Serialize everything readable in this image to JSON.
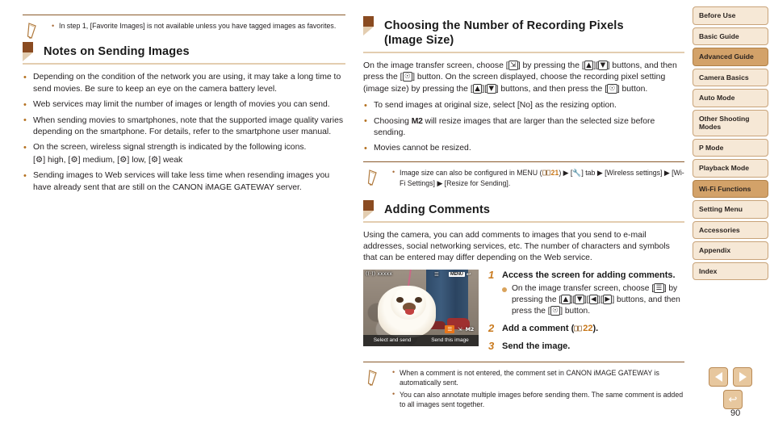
{
  "colors": {
    "heading_tag": "#8a4b21",
    "heading_rule": "#e3cdb0",
    "note_rule": "#8a5a2b",
    "bullet": "#b4701f",
    "step_number": "#c97a1e",
    "page_ref": "#c8781b",
    "nav_default_bg": "#f6e8d6",
    "nav_active_bg": "#d3a269",
    "nav_border": "#c8a379",
    "button_bg": "#e7c79e",
    "camera_highlight": "#e8751a"
  },
  "left_column": {
    "top_note": {
      "icon": "pencil-icon",
      "items": [
        "In step 1, [Favorite Images] is not available unless you have tagged images as favorites."
      ]
    },
    "heading": "Notes on Sending Images",
    "bullets": [
      "Depending on the condition of the network you are using, it may take a long time to send movies. Be sure to keep an eye on the camera battery level.",
      "Web services may limit the number of images or length of movies you can send.",
      "When sending movies to smartphones, note that the supported image quality varies depending on the smartphone. For details, refer to the smartphone user manual.",
      "On the screen, wireless signal strength is indicated by the following icons.",
      "Sending images to Web services will take less time when resending images you have already sent that are still on the CANON iMAGE GATEWAY server."
    ],
    "signal_line": {
      "entries": [
        {
          "icon": "signal-high-icon",
          "label": "high"
        },
        {
          "icon": "signal-medium-icon",
          "label": "medium"
        },
        {
          "icon": "signal-low-icon",
          "label": "low"
        },
        {
          "icon": "signal-weak-icon",
          "label": "weak"
        }
      ]
    }
  },
  "middle_column": {
    "section1": {
      "heading_line1": "Choosing the Number of Recording Pixels",
      "heading_line2": "(Image Size)",
      "paragraph_parts": {
        "p1": "On the image transfer screen, choose ",
        "icon1": "resize-icon",
        "p2": " by pressing the ",
        "icon_up": "up-button-icon",
        "icon_down": "down-button-icon",
        "p3": " buttons, and then press the ",
        "icon_func": "func-set-icon",
        "p4": " button. On the screen displayed, choose the recording pixel setting (image size) by pressing the ",
        "p5": " buttons, and then press the ",
        "p6": " button."
      },
      "bullets": [
        {
          "parts": [
            "To send images at original size, select [No] as the resizing option."
          ]
        },
        {
          "parts": [
            "Choosing ",
            "M2",
            " will resize images that are larger than the selected size before sending."
          ]
        },
        {
          "parts": [
            "Movies cannot be resized."
          ]
        }
      ],
      "note": {
        "icon": "pencil-icon",
        "text_parts": {
          "a": "Image size can also be configured in MENU (",
          "page_ref": "21",
          "b": ") ▶ [",
          "tab_icon": "wrench-tab-icon",
          "c": "] tab ▶ [Wireless settings] ▶ [Wi-Fi Settings] ▶ [Resize for Sending]."
        }
      }
    },
    "section2": {
      "heading": "Adding Comments",
      "paragraph": "Using the camera, you can add comments to images that you send to e-mail addresses, social networking services, etc. The number of characters and symbols that can be entered may differ depending on the Web service.",
      "camera_screen": {
        "wifi_label": "((·)) xxxxx",
        "signal_icon": "signal-icon",
        "menu_key": "MENU",
        "return_icon": "return-icon",
        "selected_tool_icon": "comment-icon",
        "resize_icon": "resize-icon",
        "size_label": "M2",
        "left_hint": "Select and send",
        "right_hint": "Send this image"
      },
      "steps": [
        {
          "number": "1",
          "title": "Access the screen for adding comments.",
          "substep_parts": {
            "a": "On the image transfer screen, choose [",
            "icon": "comment-icon",
            "b": "] by pressing the [",
            "up": "up-button-icon",
            "down": "down-button-icon",
            "left": "left-button-icon",
            "right": "right-button-icon",
            "c": "] buttons, and then press the [",
            "func": "func-set-icon",
            "d": "] button."
          }
        },
        {
          "number": "2",
          "title_parts": {
            "a": "Add a comment (",
            "page_ref": "22",
            "b": ")."
          }
        },
        {
          "number": "3",
          "title": "Send the image."
        }
      ],
      "note": {
        "icon": "pencil-icon",
        "items": [
          "When a comment is not entered, the comment set in CANON iMAGE GATEWAY is automatically sent.",
          "You can also annotate multiple images before sending them. The same comment is added to all images sent together."
        ]
      }
    }
  },
  "sidebar": {
    "items": [
      {
        "label": "Before Use",
        "active": false,
        "tall": false
      },
      {
        "label": "Basic Guide",
        "active": false,
        "tall": false
      },
      {
        "label": "Advanced Guide",
        "active": true,
        "tall": false
      },
      {
        "label": "Camera Basics",
        "active": false,
        "tall": false
      },
      {
        "label": "Auto Mode",
        "active": false,
        "tall": false
      },
      {
        "label": "Other Shooting Modes",
        "active": false,
        "tall": true
      },
      {
        "label": "P Mode",
        "active": false,
        "tall": false
      },
      {
        "label": "Playback Mode",
        "active": false,
        "tall": false
      },
      {
        "label": "Wi-Fi Functions",
        "active": true,
        "tall": false
      },
      {
        "label": "Setting Menu",
        "active": false,
        "tall": false
      },
      {
        "label": "Accessories",
        "active": false,
        "tall": false
      },
      {
        "label": "Appendix",
        "active": false,
        "tall": false
      },
      {
        "label": "Index",
        "active": false,
        "tall": false
      }
    ]
  },
  "footer": {
    "prev_icon": "previous-page-icon",
    "next_icon": "next-page-icon",
    "back_icon": "back-icon",
    "page_number": "90"
  }
}
